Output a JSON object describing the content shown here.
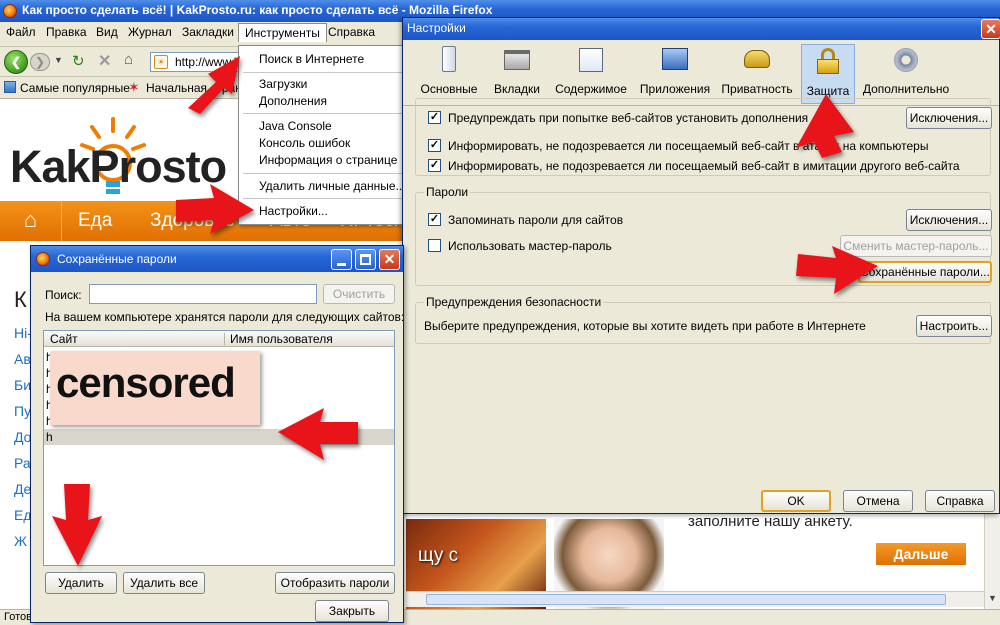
{
  "browser": {
    "title": "Как просто сделать всё! | KakProsto.ru: как просто сделать всё - Mozilla Firefox",
    "menu": [
      "Файл",
      "Правка",
      "Вид",
      "Журнал",
      "Закладки",
      "Инструменты",
      "Справка"
    ],
    "url": "http://www.kakprosto.ru/",
    "bookmarks": [
      "Самые популярные",
      "Начальная страница"
    ],
    "status": "Готово"
  },
  "site": {
    "logo": "KakProsto",
    "nav": [
      "Еда",
      "Здоровье",
      "Авто",
      "Hi-Tech"
    ],
    "heading": "К",
    "left_links": [
      "Hi-",
      "Ав",
      "Би",
      "Пу",
      "До",
      "Ра",
      "Де",
      "Ед",
      "Ж"
    ],
    "promo_text": "заполните нашу анкету.",
    "food_text": "щу с",
    "more_button": "Дальше"
  },
  "tools_menu": {
    "items": [
      "Поиск в Интернете",
      "Загрузки",
      "Дополнения",
      "Java Console",
      "Консоль ошибок",
      "Информация о странице",
      "Удалить личные данные...",
      "Настройки..."
    ]
  },
  "settings": {
    "title": "Настройки",
    "tabs": [
      "Основные",
      "Вкладки",
      "Содержимое",
      "Приложения",
      "Приватность",
      "Защита",
      "Дополнительно"
    ],
    "active_tab": "Защита",
    "warn_addons": "Предупреждать при попытке веб-сайтов установить дополнения",
    "exceptions_1": "Исключения...",
    "report_attack": "Информировать, не подозревается ли посещаемый веб-сайт в атаках на компьютеры",
    "report_forgery": "Информировать, не подозревается ли посещаемый веб-сайт в имитации другого веб-сайта",
    "passwords_group": "Пароли",
    "remember_passwords": "Запоминать пароли для сайтов",
    "exceptions_2": "Исключения...",
    "use_master": "Использовать мастер-пароль",
    "change_master": "Сменить мастер-пароль...",
    "saved_passwords": "Сохранённые пароли...",
    "security_group": "Предупреждения безопасности",
    "security_text": "Выберите предупреждения, которые вы хотите видеть при работе в Интернете",
    "configure": "Настроить...",
    "ok": "OK",
    "cancel": "Отмена",
    "help": "Справка"
  },
  "saved": {
    "title": "Сохранённые пароли",
    "search_label": "Поиск:",
    "search_value": "",
    "clear": "Очистить",
    "info": "На вашем компьютере хранятся пароли для следующих сайтов:",
    "col_site": "Сайт",
    "col_user": "Имя пользователя",
    "rows": [
      "h",
      "h",
      "h",
      "h",
      "h",
      "h"
    ],
    "censored": "censored",
    "delete": "Удалить",
    "delete_all": "Удалить все",
    "show_passwords": "Отобразить пароли",
    "close": "Закрыть"
  },
  "colors": {
    "xp_blue": "#2766d6",
    "site_orange": "#f07c00",
    "arrow_red": "#e8141a",
    "dialog_bg": "#ece9d8"
  }
}
